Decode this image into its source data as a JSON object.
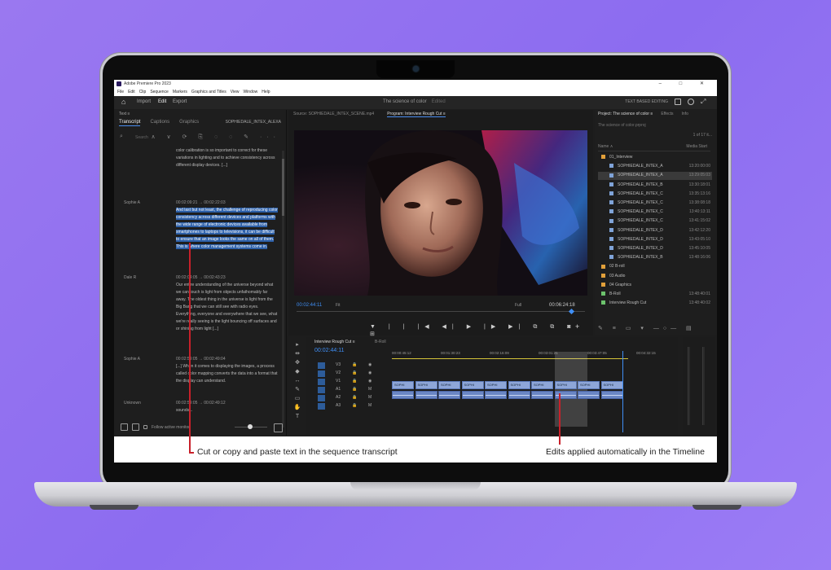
{
  "window": {
    "title": "Adobe Premiere Pro 2023",
    "controls": "–  □  ✕"
  },
  "menu": [
    "File",
    "Edit",
    "Clip",
    "Sequence",
    "Markers",
    "Graphics and Titles",
    "View",
    "Window",
    "Help"
  ],
  "header": {
    "tabs": [
      "Import",
      "Edit",
      "Export"
    ],
    "active_tab": "Edit",
    "project_title": "The science of color",
    "project_sub": "Edited",
    "right_label": "TEXT BASED EDITING"
  },
  "text_panel": {
    "top_label": "Text ≡",
    "tabs": [
      "Transcript",
      "Captions",
      "Graphics"
    ],
    "active_tab": "Transcript",
    "file_label": "SOPHIEDALE_INTEX_ALEXA",
    "search_placeholder": "Search",
    "tools": "∧ ∨  ⟳  ⎘  ◌  ◌  ✎",
    "more": "···",
    "segments": [
      {
        "speaker": "",
        "time": "",
        "text": "color calibration is so important to correct for these variations in lighting and to achieve consistency across different display devices. [...]",
        "highlight": false
      },
      {
        "speaker": "Sophie A",
        "time": "00:02:09:21 → 00:02:22:03",
        "text": "And last but not least, the challenge of reproducing color consistency across different devices and platforms with the wide range of electronic devices available from smartphones to laptops to televisions, it can be difficult to ensure that an image looks the same on all of them. This is where color management systems come in.",
        "highlight": true
      },
      {
        "speaker": "Dale R",
        "time": "00:02:04:05 → 00:02:43:23",
        "text": "Our entire understanding of the universe beyond what we can touch is light from objects unfathomably far away. The oldest thing in the universe is light from the Big Bang that we can still see with radio eyes. Everything, everyone and everywhere that we see, what we're really seeing is the light bouncing off surfaces and or shining from light [...]",
        "highlight": false
      },
      {
        "speaker": "Sophie A",
        "time": "00:02:59:05 → 00:02:49:04",
        "text": "[...] When it comes to displaying the images, a process called color mapping converts the data into a format that the display can understand.",
        "highlight": false
      },
      {
        "speaker": "Unknown",
        "time": "00:02:59:05 → 00:02:49:12",
        "text": "sounds...",
        "highlight": false
      }
    ],
    "follow_label": "Follow active monitor"
  },
  "monitor": {
    "tabs": [
      "Source: SOPHIEDALE_INTEX_SCENE.mp4",
      "Program: Interview Rough Cut ≡"
    ],
    "active_tab": "Program: Interview Rough Cut ≡",
    "timecode_left": "00:02:44:11",
    "fit": "Fit",
    "resolution": "Full",
    "timecode_right": "00:06:24:18",
    "transport": "▼  |  |  |◀  ◀|  ▶  |▶  ▶|  ⧉  ⧉  ◙  ⊞"
  },
  "project": {
    "tabs": [
      "Project: The science of color ≡",
      "Effects",
      "Info"
    ],
    "active_tab": "Project: The science of color ≡",
    "search_label": "The science of color.prproj",
    "count": "1 of 17 it...",
    "col_name": "Name ∧",
    "col_rate": "Media Start",
    "items": [
      {
        "name": "01_Interview",
        "rate": "",
        "color": "#e2a03a",
        "indent": 0,
        "selected": false
      },
      {
        "name": "SOPHIEDALE_INTEX_A",
        "rate": "13:20:00:00",
        "color": "#7fa3d8",
        "indent": 1,
        "selected": false
      },
      {
        "name": "SOPHIEDALE_INTEX_A",
        "rate": "13:29:05:03",
        "color": "#7fa3d8",
        "indent": 1,
        "selected": true
      },
      {
        "name": "SOPHIEDALE_INTEX_B",
        "rate": "13:30:18:01",
        "color": "#7fa3d8",
        "indent": 1,
        "selected": false
      },
      {
        "name": "SOPHIEDALE_INTEX_C",
        "rate": "13:35:13:16",
        "color": "#7fa3d8",
        "indent": 1,
        "selected": false
      },
      {
        "name": "SOPHIEDALE_INTEX_C",
        "rate": "13:38:08:18",
        "color": "#7fa3d8",
        "indent": 1,
        "selected": false
      },
      {
        "name": "SOPHIEDALE_INTEX_C",
        "rate": "13:40:13:11",
        "color": "#7fa3d8",
        "indent": 1,
        "selected": false
      },
      {
        "name": "SOPHIEDALE_INTEX_C",
        "rate": "13:41:15:02",
        "color": "#7fa3d8",
        "indent": 1,
        "selected": false
      },
      {
        "name": "SOPHIEDALE_INTEX_D",
        "rate": "13:42:12:20",
        "color": "#7fa3d8",
        "indent": 1,
        "selected": false
      },
      {
        "name": "SOPHIEDALE_INTEX_D",
        "rate": "13:43:05:10",
        "color": "#7fa3d8",
        "indent": 1,
        "selected": false
      },
      {
        "name": "SOPHIEDALE_INTEX_D",
        "rate": "13:45:10:05",
        "color": "#7fa3d8",
        "indent": 1,
        "selected": false
      },
      {
        "name": "SOPHIEDALE_INTEX_B",
        "rate": "13:48:16:06",
        "color": "#7fa3d8",
        "indent": 1,
        "selected": false
      },
      {
        "name": "02 B-roll",
        "rate": "",
        "color": "#e2a03a",
        "indent": 0,
        "selected": false
      },
      {
        "name": "03 Audio",
        "rate": "",
        "color": "#e2a03a",
        "indent": 0,
        "selected": false
      },
      {
        "name": "04 Graphics",
        "rate": "",
        "color": "#e2a03a",
        "indent": 0,
        "selected": false
      },
      {
        "name": "B-Roll",
        "rate": "13:48:40:01",
        "color": "#6cc26c",
        "indent": 0,
        "selected": false
      },
      {
        "name": "Interview Rough Cut",
        "rate": "13:48:40:02",
        "color": "#6cc26c",
        "indent": 0,
        "selected": false
      }
    ]
  },
  "timeline": {
    "tab": "Interview Rough Cut ≡",
    "tab2": "B-Roll",
    "timecode": "00:02:44:11",
    "ruler": [
      "00:00:45:12",
      "00:01:30:23",
      "00:02:16:09",
      "00:03:01:21",
      "00:03:47:05",
      "00:04:32:15"
    ],
    "track_labels": [
      "V3",
      "V2",
      "V1",
      "A1",
      "A2",
      "A3"
    ],
    "clip_label": "SOPHI"
  },
  "toolbar": "▸ ⇹ ✥ ◆ ↔ ✎ ▭ ✋ T",
  "callouts": {
    "left": "Cut or copy and paste text in the sequence transcript",
    "right": "Edits applied automatically in the Timeline"
  },
  "colors": {
    "background": "#9a78f0",
    "accent_blue": "#3f8ef5",
    "highlight": "#2c5fa8",
    "callout_red": "#c8202a"
  }
}
